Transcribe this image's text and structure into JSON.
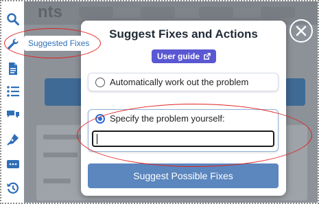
{
  "tooltip": {
    "label": "Suggested Fixes"
  },
  "background": {
    "title_fragment": "nts"
  },
  "sidebar": {
    "icons": [
      "search-icon",
      "wrench-icon",
      "document-icon",
      "list-icon",
      "chat-icon",
      "pen-icon",
      "more-icon",
      "history-icon"
    ]
  },
  "modal": {
    "title": "Suggest Fixes and Actions",
    "user_guide_label": "User guide",
    "option_auto_label": "Automatically work out the problem",
    "option_specify_label": "Specify the problem yourself:",
    "problem_input_value": "",
    "problem_input_placeholder": "",
    "submit_label": "Suggest Possible Fixes"
  },
  "colors": {
    "accent": "#2f6fb6",
    "guide_button": "#5a57d3",
    "submit_button": "#5b86be",
    "annotation": "#e0201f",
    "overlay": "#8d9299"
  }
}
